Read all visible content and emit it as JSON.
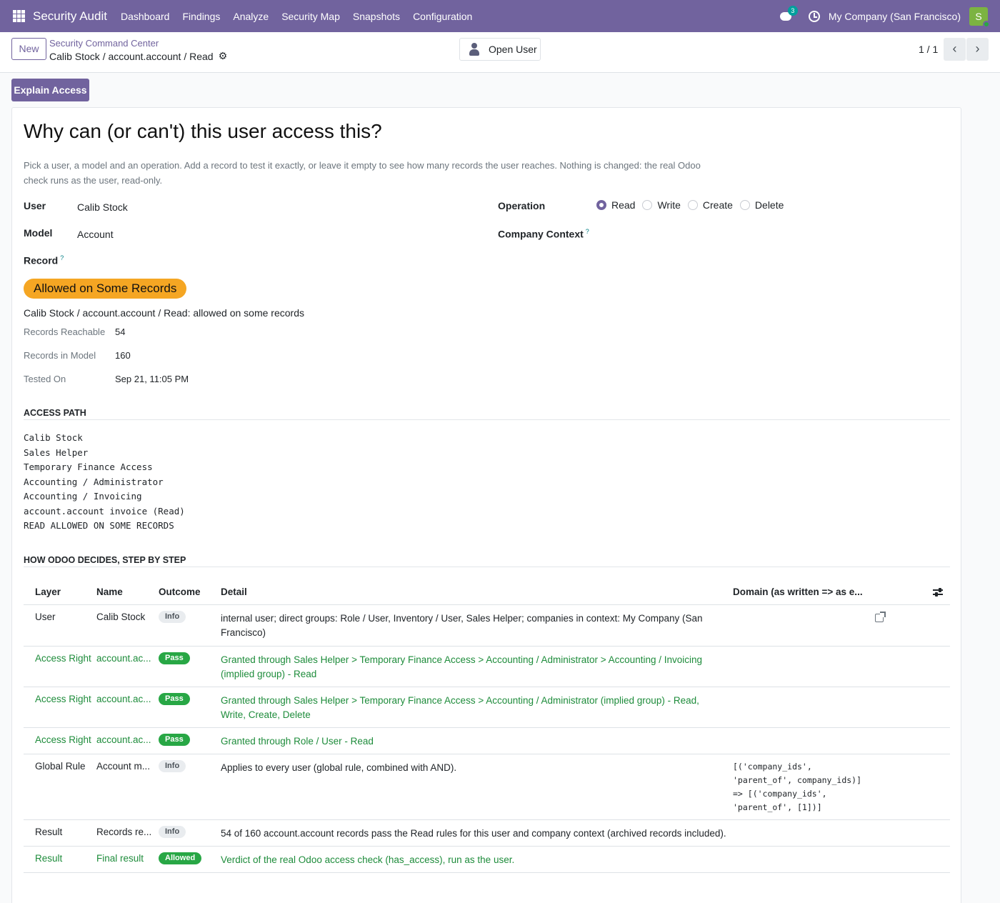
{
  "nav": {
    "brand": "Security Audit",
    "menu": [
      "Dashboard",
      "Findings",
      "Analyze",
      "Security Map",
      "Snapshots",
      "Configuration"
    ],
    "chat_count": "3",
    "company": "My Company (San Francisco)",
    "avatar_letter": "S"
  },
  "control": {
    "new_label": "New",
    "breadcrumb_parent": "Security Command Center",
    "breadcrumb_current": "Calib Stock / account.account / Read",
    "open_user_label": "Open User",
    "pager": "1 / 1"
  },
  "explain_label": "Explain Access",
  "form": {
    "title": "Why can (or can't) this user access this?",
    "intro": "Pick a user, a model and an operation. Add a record to test it exactly, or leave it empty to see how many records the user reaches. Nothing is changed: the real Odoo check runs as the user, read-only.",
    "user_label": "User",
    "user_value": "Calib Stock",
    "model_label": "Model",
    "model_value": "Account",
    "record_label": "Record",
    "help_mark": "?",
    "operation_label": "Operation",
    "operations": [
      "Read",
      "Write",
      "Create",
      "Delete"
    ],
    "operation_selected": "Read",
    "company_context_label": "Company Context"
  },
  "verdict": {
    "pill": "Allowed on Some Records",
    "summary": "Calib Stock / account.account / Read: allowed on some records",
    "records_reachable_label": "Records Reachable",
    "records_reachable": "54",
    "records_in_model_label": "Records in Model",
    "records_in_model": "160",
    "tested_on_label": "Tested On",
    "tested_on": "Sep 21, 11:05 PM",
    "pill_color": "#f5a623"
  },
  "access_path": {
    "title": "ACCESS PATH",
    "lines": [
      "Calib Stock",
      "Sales Helper",
      "Temporary Finance Access",
      "Accounting / Administrator",
      "Accounting / Invoicing",
      "account.account invoice (Read)",
      "READ ALLOWED ON SOME RECORDS"
    ]
  },
  "steps": {
    "title": "HOW ODOO DECIDES, STEP BY STEP",
    "headers": {
      "layer": "Layer",
      "name": "Name",
      "outcome": "Outcome",
      "detail": "Detail",
      "domain": "Domain (as written => as e..."
    },
    "rows": [
      {
        "layer": "User",
        "name": "Calib Stock",
        "outcome": "Info",
        "detail": "internal user; direct groups: Role / User, Inventory / User, Sales Helper; companies in context: My Company (San Francisco)",
        "domain": ""
      },
      {
        "layer": "Access Right",
        "name": "account.ac...",
        "outcome": "Pass",
        "detail": "Granted through Sales Helper > Temporary Finance Access > Accounting / Administrator > Accounting / Invoicing (implied group) - Read",
        "domain": ""
      },
      {
        "layer": "Access Right",
        "name": "account.ac...",
        "outcome": "Pass",
        "detail": "Granted through Sales Helper > Temporary Finance Access > Accounting / Administrator (implied group) - Read, Write, Create, Delete",
        "domain": ""
      },
      {
        "layer": "Access Right",
        "name": "account.ac...",
        "outcome": "Pass",
        "detail": "Granted through Role / User - Read",
        "domain": ""
      },
      {
        "layer": "Global Rule",
        "name": "Account m...",
        "outcome": "Info",
        "detail": "Applies to every user (global rule, combined with AND).",
        "domain": "[('company_ids',\n'parent_of', company_ids)]\n=> [('company_ids',\n'parent_of', [1])]"
      },
      {
        "layer": "Result",
        "name": "Records re...",
        "outcome": "Info",
        "detail": "54 of 160 account.account records pass the Read rules for this user and company context (archived records included).",
        "domain": ""
      },
      {
        "layer": "Result",
        "name": "Final result",
        "outcome": "Allowed",
        "detail": "Verdict of the real Odoo access check (has_access), run as the user.",
        "domain": ""
      }
    ]
  },
  "colors": {
    "brand": "#71639e",
    "success": "#28a745",
    "success_text": "#1e8c3b",
    "warning": "#f5a623"
  }
}
